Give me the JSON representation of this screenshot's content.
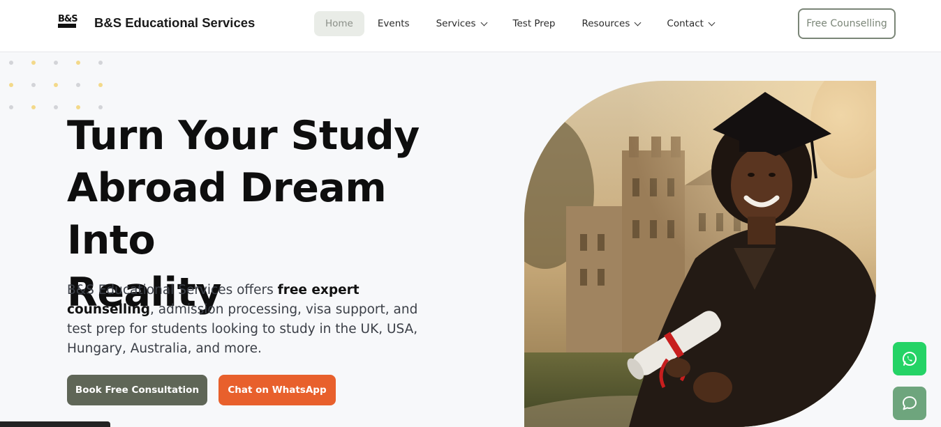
{
  "header": {
    "brand_name": "B&S Educational Services",
    "logo_text": "B&S",
    "nav": [
      {
        "label": "Home",
        "active": true,
        "dropdown": false
      },
      {
        "label": "Events",
        "active": false,
        "dropdown": false
      },
      {
        "label": "Services",
        "active": false,
        "dropdown": true
      },
      {
        "label": "Test Prep",
        "active": false,
        "dropdown": false
      },
      {
        "label": "Resources",
        "active": false,
        "dropdown": true
      },
      {
        "label": "Contact",
        "active": false,
        "dropdown": true
      }
    ],
    "cta_label": "Free Counselling"
  },
  "hero": {
    "title_line1": "Turn Your Study",
    "title_line2": "Abroad Dream Into",
    "title_line3": "Reality",
    "text_before": "B&S Educational Services offers ",
    "text_bold": "free expert counselling",
    "text_after": ", admission processing, visa support, and test prep for students looking to study in the UK, USA, Hungary, Australia, and more.",
    "primary_button": "Book Free Consultation",
    "secondary_button": "Chat on WhatsApp"
  },
  "floating": {
    "whatsapp_icon": "whatsapp-icon",
    "chat_icon": "chat-bubble-icon"
  },
  "colors": {
    "accent_olive": "#5f6657",
    "accent_orange": "#e8602c",
    "whatsapp_green": "#25d366",
    "chat_green": "#6ea57d"
  }
}
